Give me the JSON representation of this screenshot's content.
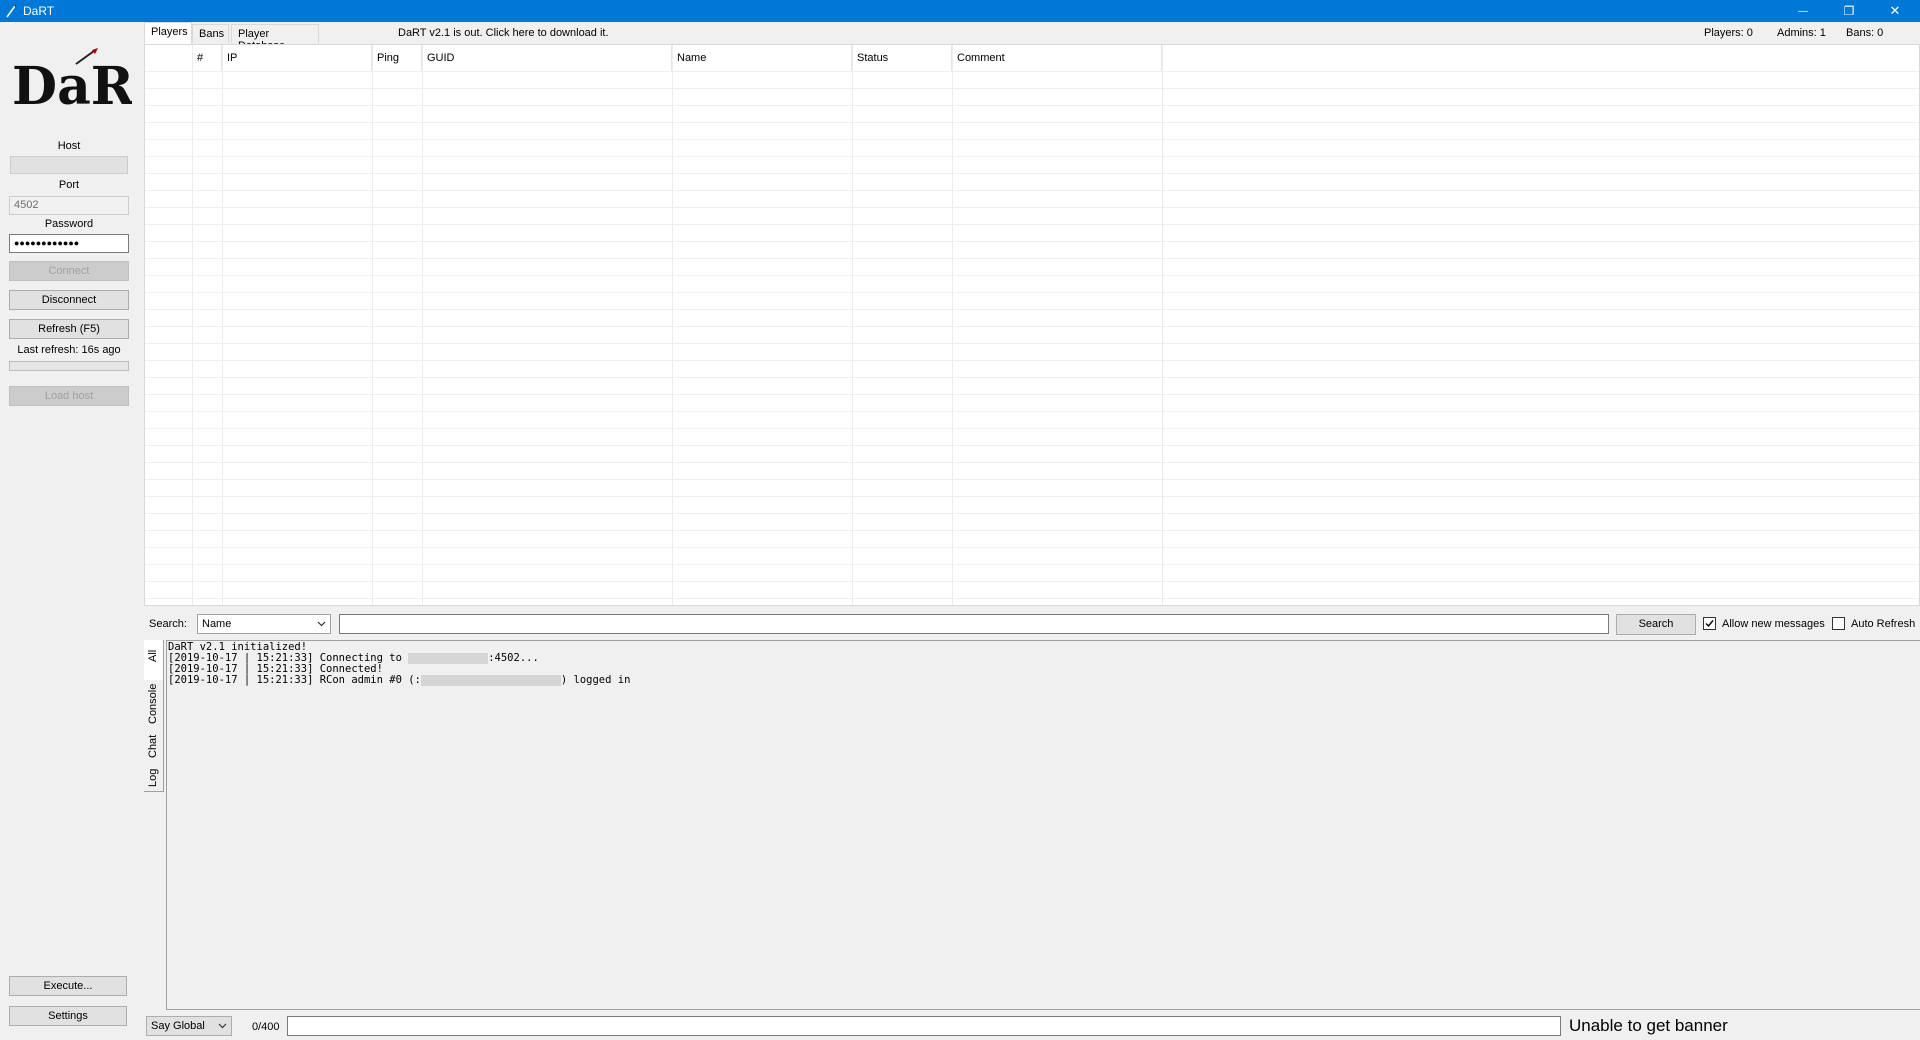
{
  "window": {
    "title": "DaRT",
    "minimize_glyph": "—",
    "restore_glyph": "❐",
    "close_glyph": "✕"
  },
  "sidebar": {
    "logo_text": "DaRT",
    "host_label": "Host",
    "host_value": "",
    "port_label": "Port",
    "port_value": "4502",
    "password_label": "Password",
    "password_value": "●●●●●●●●●●●●",
    "connect_label": "Connect",
    "disconnect_label": "Disconnect",
    "refresh_label": "Refresh (F5)",
    "last_refresh": "Last refresh: 16s ago",
    "load_host_label": "Load host",
    "execute_label": "Execute...",
    "settings_label": "Settings"
  },
  "tabs": [
    {
      "label": "Players",
      "active": true
    },
    {
      "label": "Bans",
      "active": false
    },
    {
      "label": "Player Database",
      "active": false
    }
  ],
  "download_notice": "DaRT v2.1 is out. Click here to download it.",
  "stats": {
    "players": "Players: 0",
    "admins": "Admins: 1",
    "bans": "Bans: 0"
  },
  "grid": {
    "columns": [
      "#",
      "IP",
      "Ping",
      "GUID",
      "Name",
      "Status",
      "Comment"
    ],
    "rows": []
  },
  "search": {
    "label": "Search:",
    "field_selected": "Name",
    "query": "",
    "button_label": "Search",
    "allow_new_messages_label": "Allow new messages",
    "allow_new_messages_checked": true,
    "auto_refresh_label": "Auto Refresh",
    "auto_refresh_checked": false
  },
  "log_tabs": [
    "All",
    "Console",
    "Chat",
    "Log"
  ],
  "log": {
    "line1": "DaRT v2.1 initialized!",
    "line2_prefix": "[2019-10-17 | 15:21:33] Connecting to ",
    "line2_suffix": ":4502...",
    "line3": "[2019-10-17 | 15:21:33] Connected!",
    "line4_prefix": "[2019-10-17 | 15:21:33] RCon admin #0 (",
    "line4_mid": ":",
    "line4_suffix": ") logged in"
  },
  "bottom": {
    "say_selected": "Say Global",
    "char_count": "0/400",
    "message": "",
    "banner_status": "Unable to get banner"
  },
  "colors": {
    "titlebar": "#0078d7",
    "background": "#f0f0f0"
  }
}
